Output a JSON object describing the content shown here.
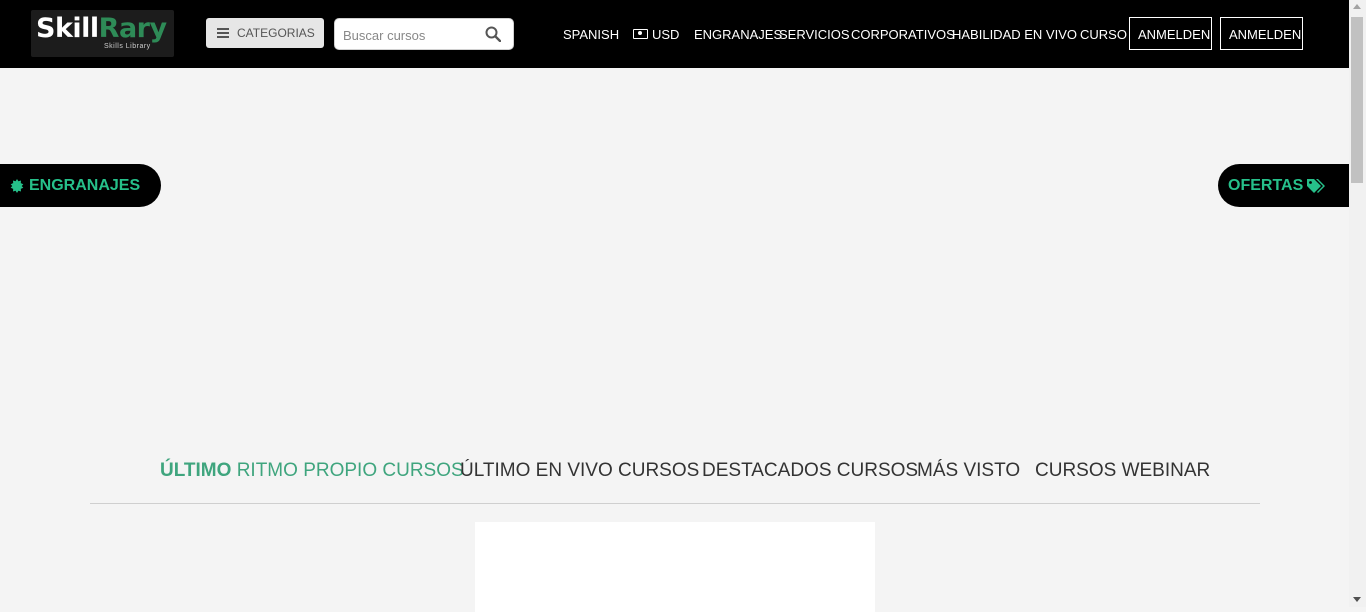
{
  "brand": {
    "name_part1": "Skill",
    "name_part2": "Rary",
    "tagline": "Skills Library"
  },
  "header": {
    "categories_label": "CATEGORIAS",
    "search": {
      "placeholder": "Buscar cursos",
      "value": ""
    },
    "language": "SPANISH",
    "currency": "USD",
    "nav": [
      "ENGRANAJES",
      "SERVICIOS",
      "CORPORATIVOS",
      "HABILIDAD EN VIVO",
      "CURSO"
    ],
    "login_buttons": [
      "ANMELDEN",
      "ANMELDEN"
    ]
  },
  "side_tabs": {
    "left_label": "ENGRANAJES",
    "right_label": "OFERTAS"
  },
  "course_tabs": {
    "active": {
      "bold": "ÚLTIMO",
      "rest": "RITMO PROPIO CURSOS"
    },
    "items": [
      "ÚLTIMO EN VIVO CURSOS",
      "DESTACADOS CURSOS",
      "MÁS VISTO",
      "CURSOS WEBINAR"
    ]
  },
  "colors": {
    "accent": "#3fa57e",
    "badge_green": "#26c08a",
    "navbar": "#000000",
    "page_bg": "#f4f4f4"
  },
  "icons": {
    "categories": "menu-icon",
    "search": "search-icon",
    "currency": "money-icon",
    "left_tab": "gear-badge-icon",
    "right_tab": "tags-icon"
  }
}
